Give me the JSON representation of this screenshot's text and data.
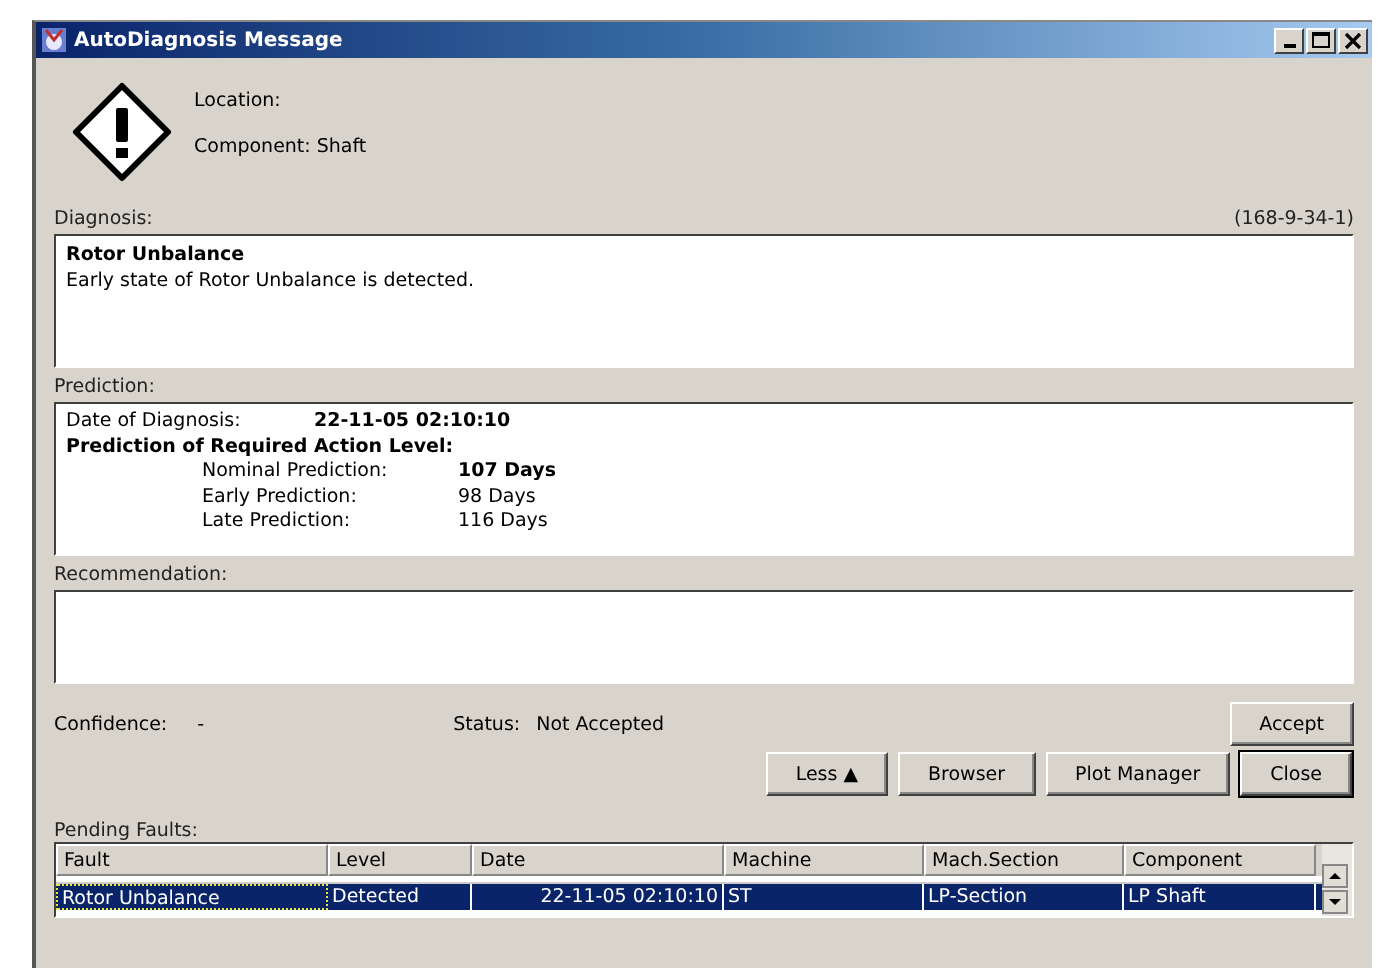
{
  "window": {
    "title": "AutoDiagnosis Message"
  },
  "header": {
    "location": "Location:",
    "component": "Component: Shaft"
  },
  "diagnosis": {
    "label": "Diagnosis:",
    "code": "(168-9-34-1)",
    "title": "Rotor Unbalance",
    "text": "Early state of Rotor Unbalance is detected."
  },
  "prediction": {
    "label": "Prediction:",
    "date_label": "Date of Diagnosis:",
    "date": "22-11-05 02:10:10",
    "heading": "Prediction of Required Action Level:",
    "rows": [
      {
        "label": "Nominal Prediction:",
        "value": "107 Days",
        "bold": true
      },
      {
        "label": "Early Prediction:",
        "value": "98 Days",
        "bold": false
      },
      {
        "label": "Late Prediction:",
        "value": "116 Days",
        "bold": false
      }
    ]
  },
  "recommendation": {
    "label": "Recommendation:"
  },
  "confidence": {
    "label": "Confidence:",
    "value": "-"
  },
  "status": {
    "label": "Status:",
    "value": "Not Accepted"
  },
  "accept_button": "Accept",
  "buttons": [
    {
      "label": "Less",
      "arrow": "▲",
      "default": false
    },
    {
      "label": "Browser",
      "default": false
    },
    {
      "label": "Plot Manager",
      "default": false
    },
    {
      "label": "Close",
      "default": true
    }
  ],
  "pending_faults": {
    "label": "Pending Faults:",
    "columns": [
      "Fault",
      "Level",
      "Date",
      "Machine",
      "Mach.Section",
      "Component"
    ],
    "rows": [
      {
        "cells": [
          "Rotor Unbalance",
          "Detected",
          "22-11-05 02:10:10",
          "ST",
          "LP-Section",
          "LP Shaft"
        ],
        "selected": true
      }
    ]
  }
}
